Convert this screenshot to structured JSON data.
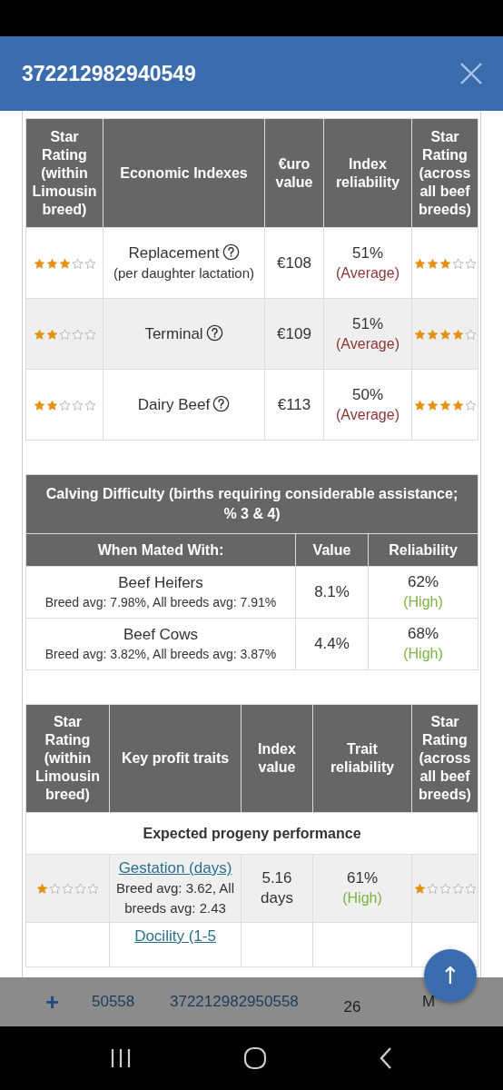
{
  "header": {
    "title": "372212982940549"
  },
  "economic_table": {
    "columns": [
      "Star Rating (within Limousin breed)",
      "Economic Indexes",
      "€uro value",
      "Index reliability",
      "Star Rating (across all beef breeds)"
    ],
    "rows": [
      {
        "within_breed": {
          "stars": 3
        },
        "index": "Replacement",
        "note": "(per daughter lactation)",
        "value": "€108",
        "reliability": {
          "percent": "51%",
          "label": "(Average)",
          "color": "#8b3535"
        },
        "across_breeds": {
          "stars": 3
        }
      },
      {
        "within_breed": {
          "stars": 2
        },
        "index": "Terminal",
        "value": "€109",
        "reliability": {
          "percent": "51%",
          "label": "(Average)",
          "color": "#8b3535"
        },
        "across_breeds": {
          "stars": 4
        }
      },
      {
        "within_breed": {
          "stars": 2
        },
        "index": "Dairy Beef",
        "value": "€113",
        "reliability": {
          "percent": "50%",
          "label": "(Average)",
          "color": "#8b3535"
        },
        "across_breeds": {
          "stars": 4
        }
      }
    ]
  },
  "calving_table": {
    "title": "Calving Difficulty (births requiring considerable assistance; % 3 & 4)",
    "columns": [
      "When Mated With:",
      "Value",
      "Reliability"
    ],
    "rows": [
      {
        "mated_with": "Beef Heifers",
        "averages": "Breed avg: 7.98%, All breeds avg: 7.91%",
        "value": "8.1%",
        "reliability": {
          "percent": "62%",
          "label": "(High)",
          "color": "#7cb342"
        }
      },
      {
        "mated_with": "Beef Cows",
        "averages": "Breed avg: 3.82%, All breeds avg: 3.87%",
        "value": "4.4%",
        "reliability": {
          "percent": "68%",
          "label": "(High)",
          "color": "#7cb342"
        }
      }
    ]
  },
  "traits_table": {
    "columns": [
      "Star Rating (within Limousin breed)",
      "Key profit traits",
      "Index value",
      "Trait reliability",
      "Star Rating (across all beef breeds)"
    ],
    "section": "Expected progeny performance",
    "rows": [
      {
        "within_breed": {
          "stars": 1
        },
        "trait": "Gestation (days)",
        "averages": "Breed avg: 3.62, All breeds avg: 2.43",
        "value": "5.16 days",
        "reliability": {
          "percent": "61%",
          "label": "(High)",
          "color": "#7cb342"
        },
        "across_breeds": {
          "stars": 1
        }
      },
      {
        "trait": "Docility (1-5"
      }
    ]
  },
  "list_row": {
    "expand": "+",
    "id": "50558",
    "tag": "372212982950558",
    "date": "26",
    "column_5": "M"
  },
  "scroll_top_button": {
    "label": "↑"
  }
}
